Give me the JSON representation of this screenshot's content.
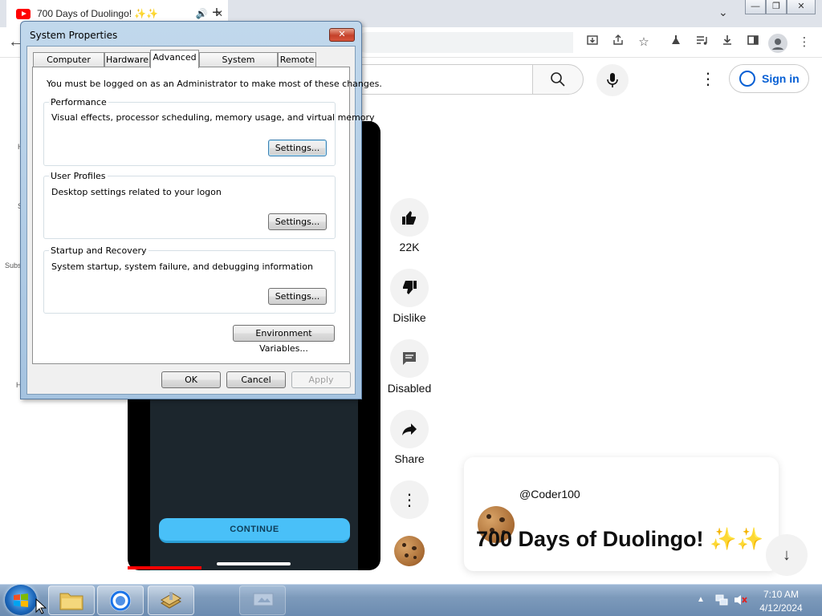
{
  "browser": {
    "tab_title": "700 Days of Duolingo! ✨✨",
    "new_tab": "+",
    "tab_list": "⌄",
    "window_controls": [
      "—",
      "❐",
      "✕"
    ]
  },
  "youtube": {
    "sign_in": "Sign in",
    "side_fragments": [
      "H",
      "S",
      "Subs",
      "H"
    ],
    "actions": {
      "likes": "22K",
      "dislike": "Dislike",
      "comments": "Disabled",
      "share": "Share"
    },
    "video_button": "CONTINUE",
    "channel": "@Coder100",
    "title": "700 Days of Duolingo! ✨✨"
  },
  "dialog": {
    "title": "System Properties",
    "tabs": [
      "Computer Name",
      "Hardware",
      "Advanced",
      "System Protection",
      "Remote"
    ],
    "active_tab": "Advanced",
    "admin_note": "You must be logged on as an Administrator to make most of these changes.",
    "performance": {
      "label": "Performance",
      "description": "Visual effects, processor scheduling, memory usage, and virtual memory",
      "button": "Settings..."
    },
    "user_profiles": {
      "label": "User Profiles",
      "description": "Desktop settings related to your logon",
      "button": "Settings..."
    },
    "startup_recovery": {
      "label": "Startup and Recovery",
      "description": "System startup, system failure, and debugging information",
      "button": "Settings..."
    },
    "env_button": "Environment Variables...",
    "ok": "OK",
    "cancel": "Cancel",
    "apply": "Apply"
  },
  "taskbar": {
    "time": "7:10 AM",
    "date": "4/12/2024",
    "tray_arrow": "▲"
  },
  "colors": {
    "youtube_red": "#ff0000",
    "signin_blue": "#065fd4",
    "continue_blue": "#49c0f8"
  }
}
